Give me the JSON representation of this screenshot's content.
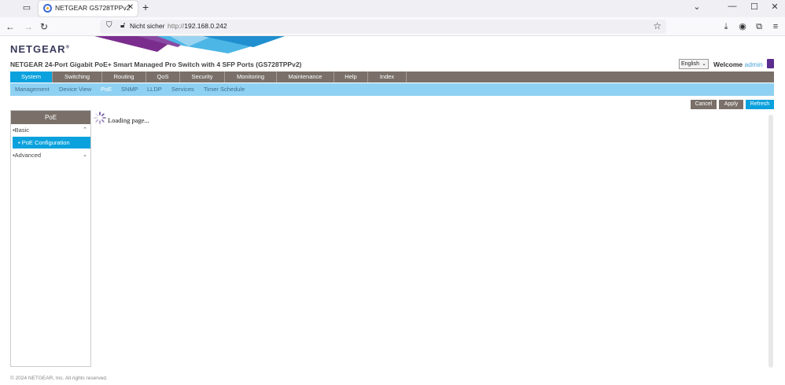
{
  "browser": {
    "tab_title": "NETGEAR GS728TPPv2",
    "insecure_label": "Nicht sicher",
    "url_scheme": "http://",
    "url_host": "192.168.0.242"
  },
  "header": {
    "logo": "NETGEAR",
    "product_title": "NETGEAR 24-Port Gigabit PoE+ Smart Managed Pro Switch with 4 SFP Ports (GS728TPPv2)",
    "language": "English",
    "welcome": "Welcome",
    "username": "admin"
  },
  "main_menu": [
    "System",
    "Switching",
    "Routing",
    "QoS",
    "Security",
    "Monitoring",
    "Maintenance",
    "Help",
    "Index"
  ],
  "sub_menu": [
    "Management",
    "Device View",
    "PoE",
    "SNMP",
    "LLDP",
    "Services",
    "Timer Schedule"
  ],
  "actions": {
    "cancel": "Cancel",
    "apply": "Apply",
    "refresh": "Refresh"
  },
  "left_nav": {
    "header": "PoE",
    "basic": "Basic",
    "poe_configuration": "PoE Configuration",
    "advanced": "Advanced"
  },
  "content": {
    "loading": "Loading page..."
  },
  "footer": "© 2024 NETGEAR, Inc. All rights reserved.",
  "colors": {
    "accent": "#0aa1dd",
    "menu_bg": "#7a7069",
    "submenu_bg": "#8fd1f2",
    "brand_purple": "#5c2d91"
  }
}
